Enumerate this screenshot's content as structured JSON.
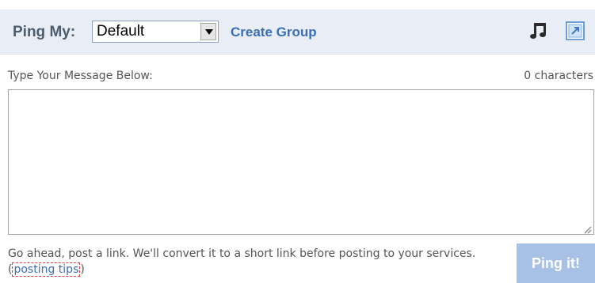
{
  "header": {
    "ping_label": "Ping My:",
    "group_select": {
      "value": "Default"
    },
    "create_group_label": "Create Group",
    "icons": {
      "music": "music-note-icon",
      "expand": "expand-icon"
    }
  },
  "composer": {
    "label": "Type Your Message Below:",
    "char_count": "0 characters",
    "message_value": "",
    "note_text": "Go ahead, post a link. We'll convert it to a short link before posting to your services. (",
    "tips_link": "posting tips",
    "note_close": ")",
    "submit_label": "Ping it!"
  },
  "colors": {
    "header_bg": "#e9eef6",
    "link": "#3b6eb6",
    "button_bg": "#a7c1e5"
  }
}
